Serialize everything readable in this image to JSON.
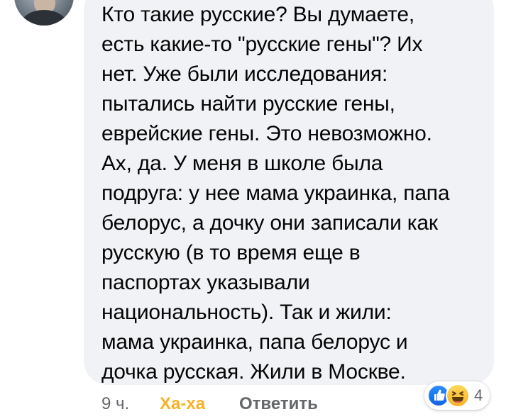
{
  "comment": {
    "lines": [
      "Кто такие русские? Вы думаете,",
      "есть какие-то \"русские гены\"? Их",
      "нет. Уже были исследования:",
      "пытались найти русские гены,",
      "еврейские гены. Это невозможно.",
      "Ах, да. У меня в школе была",
      "подруга: у нее мама украинка, папа",
      "белорус, а дочку они записали как",
      "русскую (в то время еще в",
      "паспортах указывали",
      "национальность). Так и жили:",
      "мама украинка, папа белорус и",
      "дочка русская. Жили в Москве."
    ]
  },
  "actions": {
    "time": "9 ч.",
    "reaction_label": "Ха-ха",
    "reply_label": "Ответить"
  },
  "reactions": {
    "icons": [
      "like-icon",
      "haha-icon"
    ],
    "count": "4"
  },
  "colors": {
    "bubble": "#f0f2f5",
    "text": "#050505",
    "muted": "#65676b",
    "haha": "#f7b125",
    "like": "#1877f2"
  }
}
